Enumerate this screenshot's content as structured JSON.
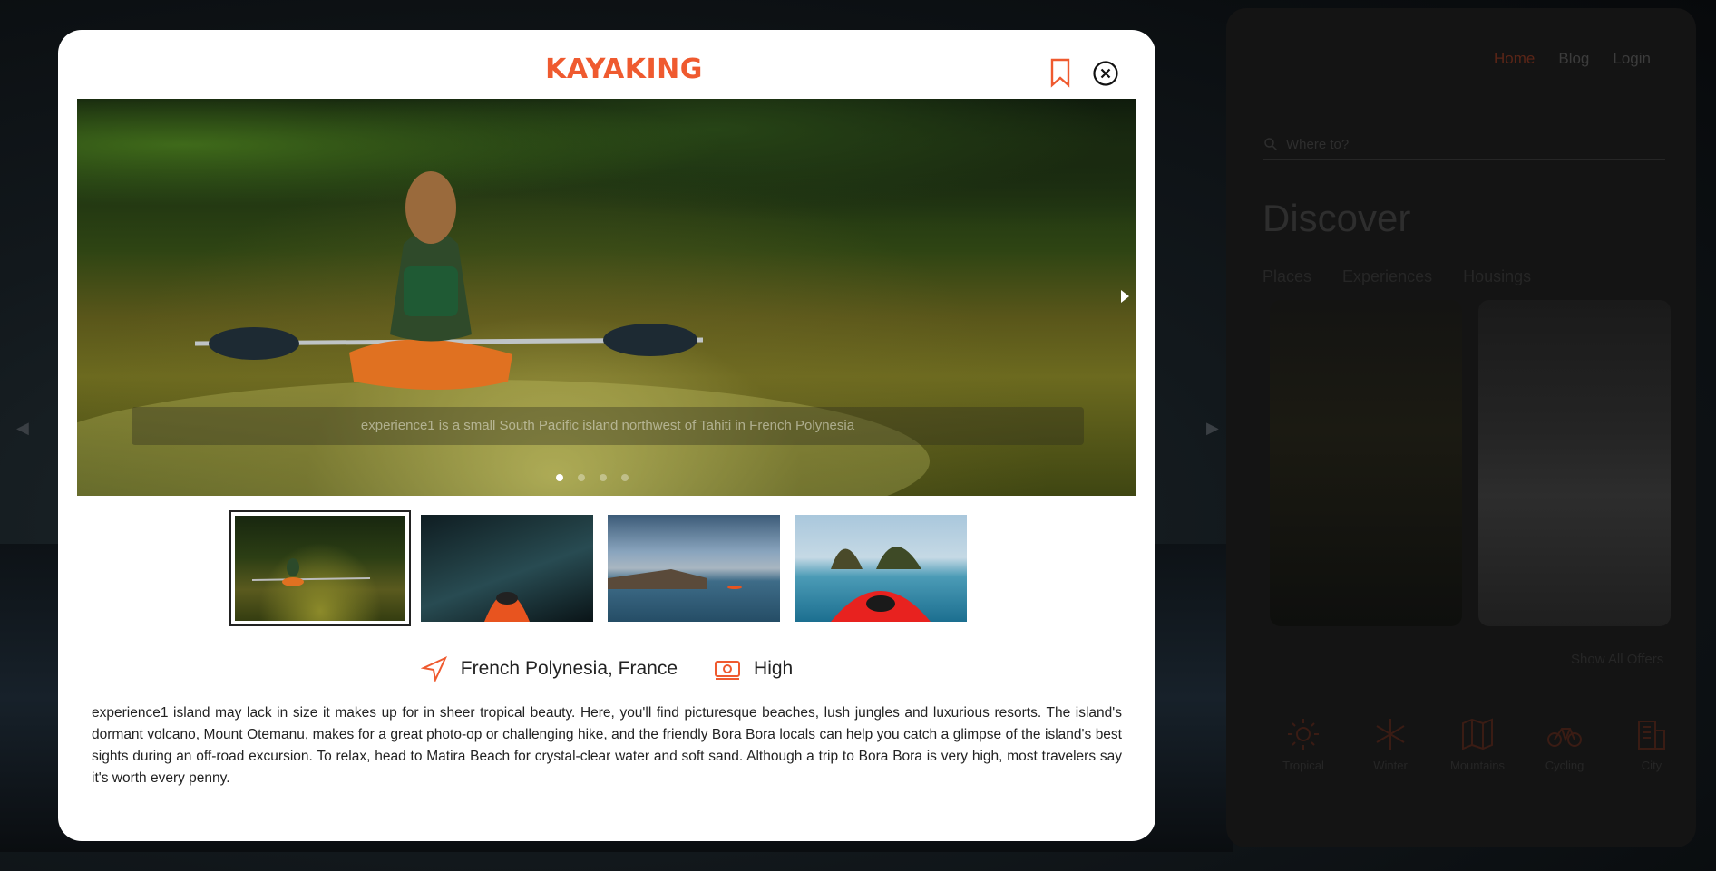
{
  "background": {
    "nav": {
      "home": "Home",
      "blog": "Blog",
      "login": "Login"
    },
    "search": {
      "placeholder": "Where to?"
    },
    "discover_title": "Discover",
    "tabs": [
      "Places",
      "Experiences",
      "Housings"
    ],
    "show_all": "Show All Offers",
    "categories": [
      {
        "label": "Tropical",
        "icon": "sun-icon"
      },
      {
        "label": "Winter",
        "icon": "snowflake-icon"
      },
      {
        "label": "Mountains",
        "icon": "map-icon"
      },
      {
        "label": "Cycling",
        "icon": "bicycle-icon"
      },
      {
        "label": "City",
        "icon": "building-icon"
      }
    ]
  },
  "modal": {
    "title": "KAYAKING",
    "hero_caption": "experience1 is a small South Pacific island northwest of Tahiti in French Polynesia",
    "slides_count": 4,
    "active_slide": 1,
    "location": "French Polynesia, France",
    "price": "High",
    "description": "experience1 island may lack in size it makes up for in sheer tropical beauty. Here, you'll find picturesque beaches, lush jungles and luxurious resorts. The island's dormant volcano, Mount Otemanu, makes for a great photo-op or challenging hike, and the friendly Bora Bora locals can help you catch a glimpse of the island's best sights during an off-road excursion. To relax, head to Matira Beach for crystal-clear water and soft sand. Although a trip to Bora Bora is very high, most travelers say it's worth every penny."
  },
  "colors": {
    "accent": "#ef5a2f",
    "text": "#222222",
    "overlay": "#0b0e12"
  }
}
